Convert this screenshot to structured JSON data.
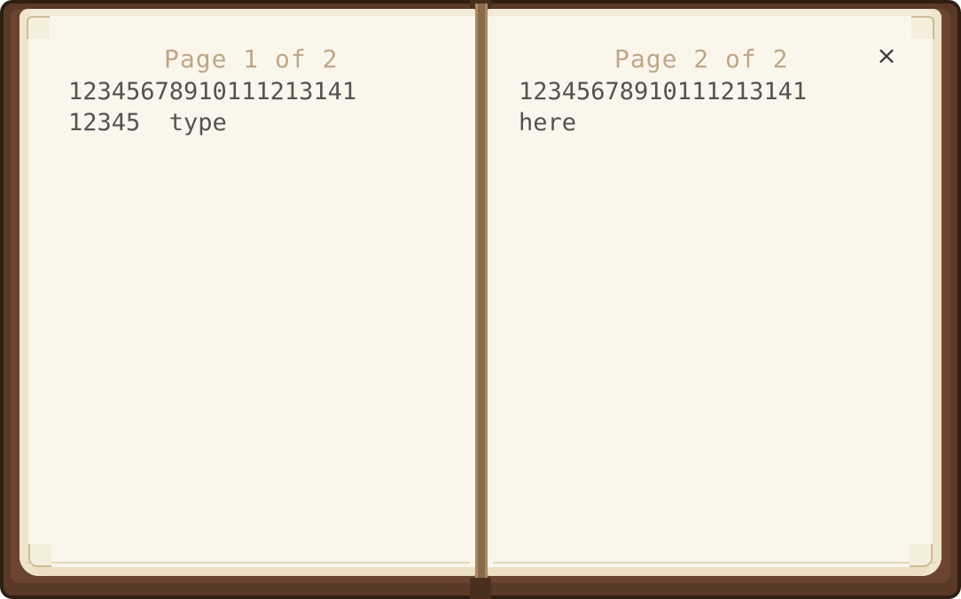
{
  "book": {
    "left_page": {
      "header": "Page 1 of 2",
      "lines": [
        "12345678910111213141",
        "12345  type"
      ]
    },
    "right_page": {
      "header": "Page 2 of 2",
      "lines": [
        "12345678910111213141",
        "here"
      ]
    },
    "close_label": "×"
  },
  "colors": {
    "cover": "#5a3a26",
    "paper": "#fbf6ec",
    "page_number_text": "#bfa788",
    "body_text": "#525250"
  },
  "icons": {
    "close": "close-icon"
  }
}
